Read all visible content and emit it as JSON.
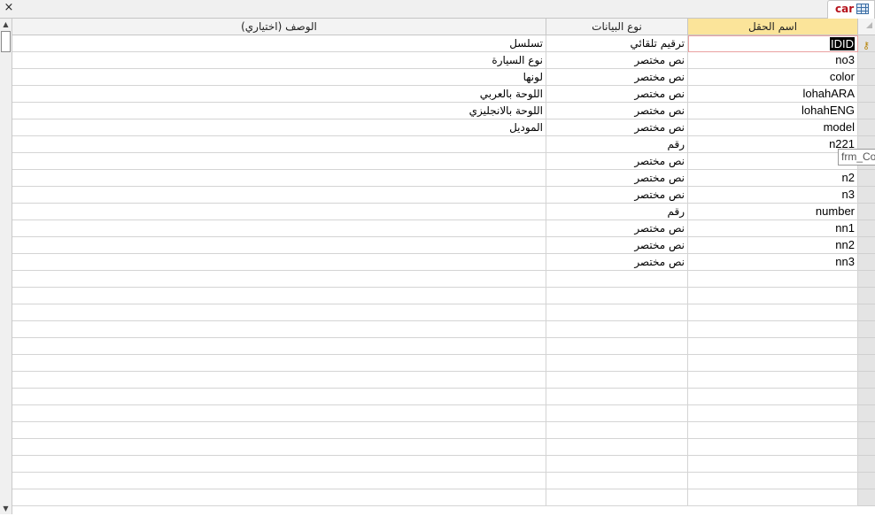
{
  "window": {
    "close_label": "×",
    "tab": {
      "title": "car",
      "icon": "table-icon"
    }
  },
  "columns": {
    "field_name": "اسم الحقل",
    "data_type": "نوع البيانات",
    "description": "الوصف (اختياري)"
  },
  "fields": [
    {
      "name": "IDID",
      "type": "ترقيم تلقائي",
      "description": "تسلسل",
      "primary_key": true,
      "current": true
    },
    {
      "name": "no3",
      "type": "نص مختصر",
      "description": "نوع السيارة"
    },
    {
      "name": "color",
      "type": "نص مختصر",
      "description": "لونها"
    },
    {
      "name": "lohahARA",
      "type": "نص مختصر",
      "description": "اللوحة بالعربي"
    },
    {
      "name": "lohahENG",
      "type": "نص مختصر",
      "description": "اللوحة بالانجليزي"
    },
    {
      "name": "model",
      "type": "نص مختصر",
      "description": "الموديل"
    },
    {
      "name": "n221",
      "type": "رقم",
      "description": ""
    },
    {
      "name": "",
      "type": "نص مختصر",
      "description": ""
    },
    {
      "name": "n2",
      "type": "نص مختصر",
      "description": ""
    },
    {
      "name": "n3",
      "type": "نص مختصر",
      "description": ""
    },
    {
      "name": "number",
      "type": "رقم",
      "description": ""
    },
    {
      "name": "nn1",
      "type": "نص مختصر",
      "description": ""
    },
    {
      "name": "nn2",
      "type": "نص مختصر",
      "description": ""
    },
    {
      "name": "nn3",
      "type": "نص مختصر",
      "description": ""
    }
  ],
  "empty_rows": 14,
  "tooltip": "frm_Co",
  "colors": {
    "header_active": "#fbe49a",
    "tab_text": "#b5121b"
  }
}
